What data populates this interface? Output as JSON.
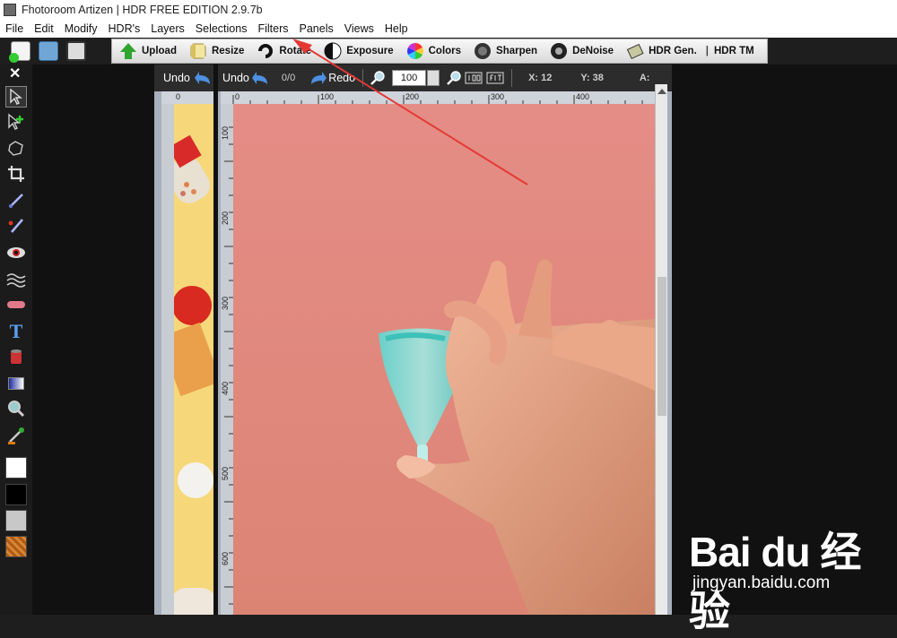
{
  "window": {
    "title": "Fhotoroom Artizen | HDR FREE EDITION 2.9.7b"
  },
  "menu": [
    "File",
    "Edit",
    "Modify",
    "HDR's",
    "Layers",
    "Selections",
    "Filters",
    "Panels",
    "Views",
    "Help"
  ],
  "toolbar": {
    "upload": "Upload",
    "resize": "Resize",
    "rotate": "Rotate",
    "exposure": "Exposure",
    "colors": "Colors",
    "sharpen": "Sharpen",
    "denoise": "DeNoise",
    "hdr_gen": "HDR Gen.",
    "hdr_tm": "HDR TM"
  },
  "nav_panel": {
    "undo": "Undo"
  },
  "main_panel": {
    "undo": "Undo",
    "history": "0/0",
    "redo": "Redo",
    "zoom": "100",
    "x": "X: 12",
    "y": "Y: 38",
    "a": "A:"
  },
  "ruler": {
    "h": [
      "0",
      "100",
      "200",
      "300",
      "400"
    ],
    "v": [
      "100",
      "200",
      "300",
      "400",
      "500",
      "600"
    ],
    "nav_h": "0"
  },
  "watermark": {
    "brand": "Bai du 经验",
    "sub": "jingyan.baidu.com"
  },
  "colors": {
    "accent_red": "#e53935",
    "canvas_pink": "#e0897f"
  }
}
